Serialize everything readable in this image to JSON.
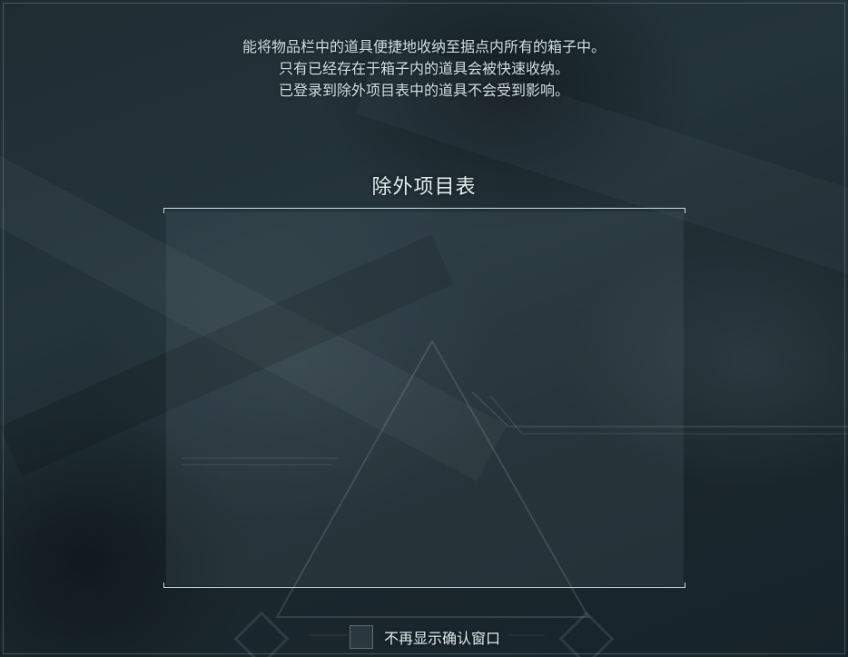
{
  "description": {
    "line1": "能将物品栏中的道具便捷地收纳至据点内所有的箱子中。",
    "line2": "只有已经存在于箱子内的道具会被快速收纳。",
    "line3": "已登录到除外项目表中的道具不会受到影响。"
  },
  "exclusion_list": {
    "title": "除外项目表",
    "items": []
  },
  "footer": {
    "dont_show_again_label": "不再显示确认窗口",
    "dont_show_again_checked": false
  },
  "colors": {
    "text": "#cfe0e6",
    "bracket": "#c9dde3",
    "background": "#1f2d33"
  },
  "icons": {
    "checkbox": "empty-checkbox",
    "background_emblem": "triangle-emblem"
  }
}
